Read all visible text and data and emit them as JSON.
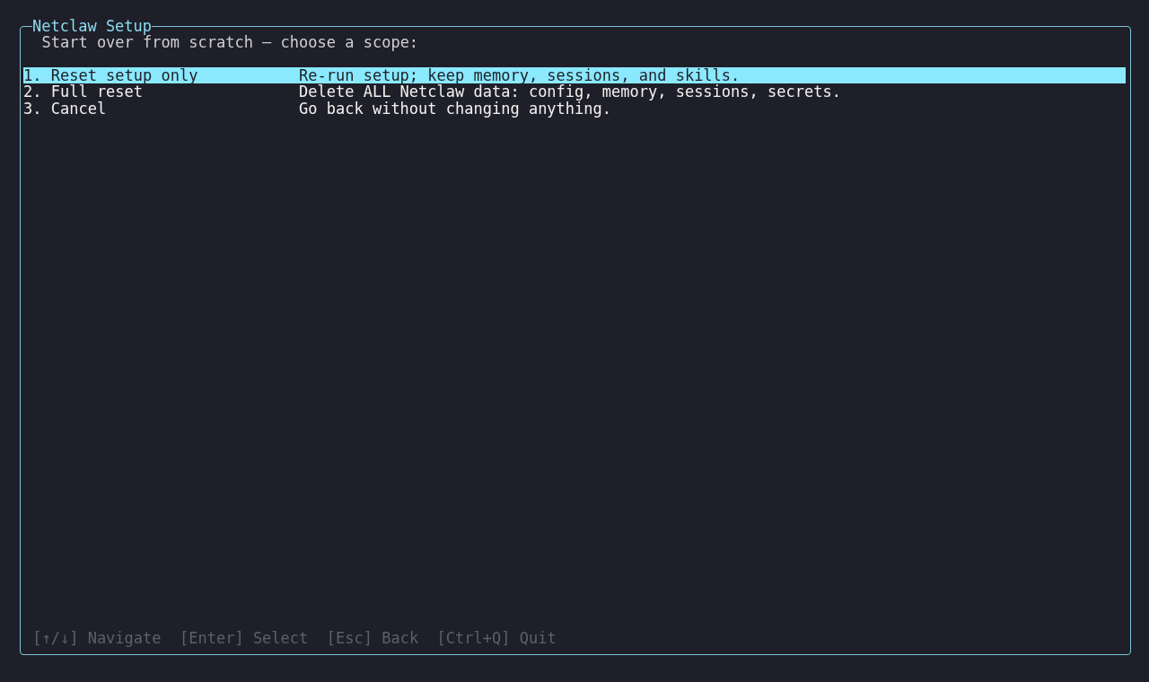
{
  "window": {
    "title": "Netclaw Setup"
  },
  "prompt": "Start over from scratch — choose a scope:",
  "options": [
    {
      "label": "1. Reset setup only",
      "description": "Re-run setup; keep memory, sessions, and skills.",
      "selected": true
    },
    {
      "label": "2. Full reset",
      "description": "Delete ALL Netclaw data: config, memory, sessions, secrets.",
      "selected": false
    },
    {
      "label": "3. Cancel",
      "description": "Go back without changing anything.",
      "selected": false
    }
  ],
  "footer_hints": [
    "[↑/↓] Navigate",
    "[Enter] Select",
    "[Esc] Back",
    "[Ctrl+Q] Quit"
  ]
}
